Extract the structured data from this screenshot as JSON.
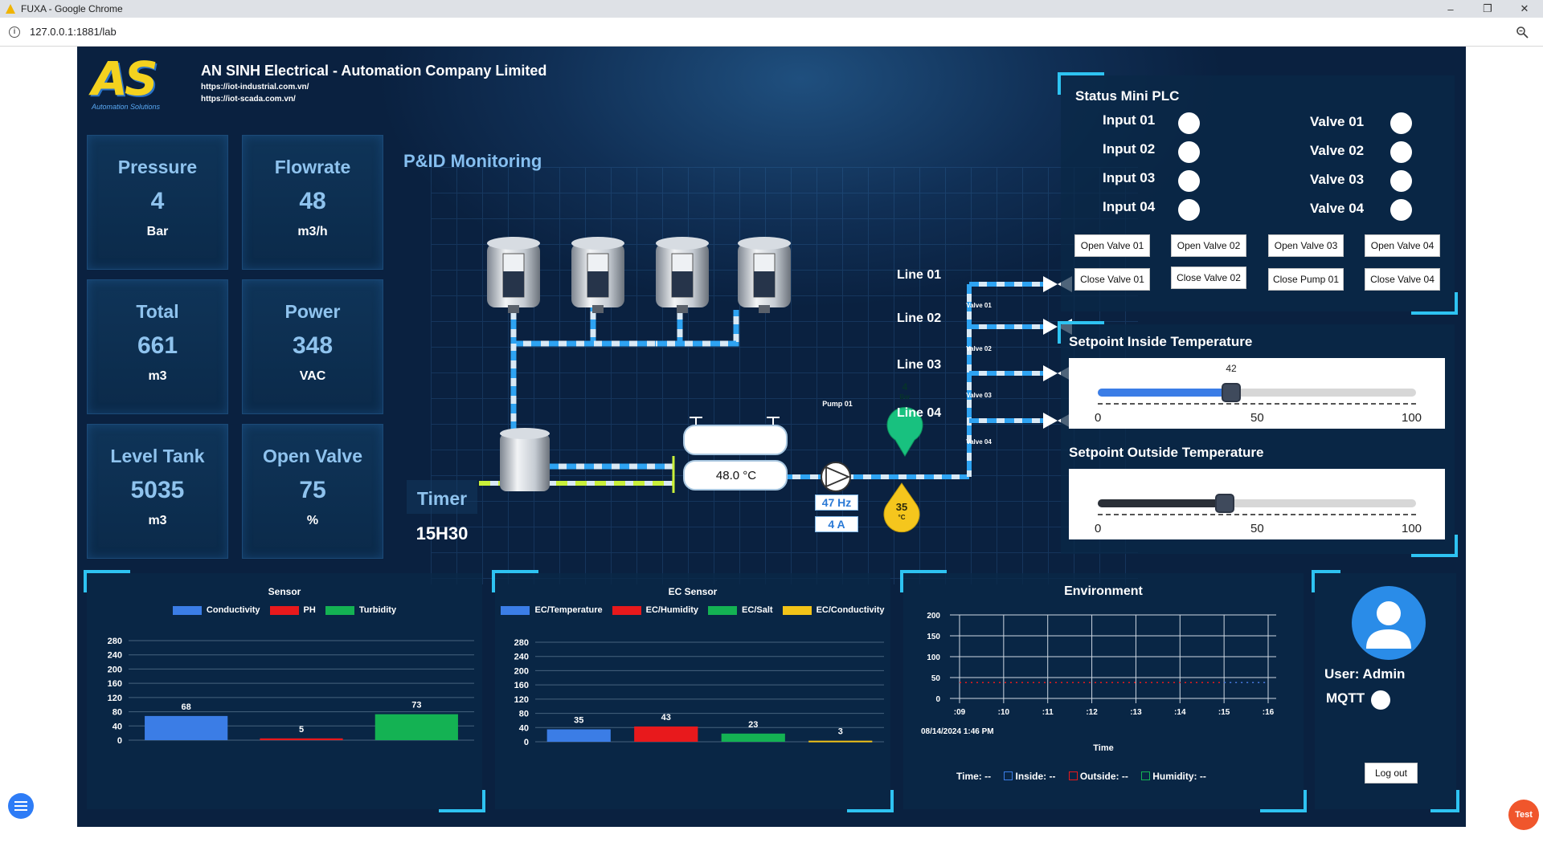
{
  "browser": {
    "window_title": "FUXA - Google Chrome",
    "url": "127.0.0.1:1881/lab"
  },
  "header": {
    "logo_text": "AS",
    "logo_sub": "Automation Solutions",
    "company_name": "AN SINH Electrical - Automation Company Limited",
    "link1": "https://iot-industrial.com.vn/",
    "link2": "https://iot-scada.com.vn/"
  },
  "cards": [
    {
      "title": "Pressure",
      "value": "4",
      "unit": "Bar"
    },
    {
      "title": "Flowrate",
      "value": "48",
      "unit": "m3/h"
    },
    {
      "title": "Total",
      "value": "661",
      "unit": "m3"
    },
    {
      "title": "Power",
      "value": "348",
      "unit": "VAC"
    },
    {
      "title": "Level Tank",
      "value": "5035",
      "unit": "m3"
    },
    {
      "title": "Open Valve",
      "value": "75",
      "unit": "%"
    }
  ],
  "pid": {
    "title": "P&ID Monitoring",
    "tank_temp": "48.0  °C",
    "pump_label": "Pump 01",
    "freq": "47 Hz",
    "current": "4 A",
    "pressure_value": "4",
    "pressure_unit": "Bar",
    "temp_value": "35",
    "temp_unit": "°C",
    "lines": [
      "Line 01",
      "Line 02",
      "Line 03",
      "Line 04"
    ],
    "valves": [
      "Valve 01",
      "Valve 02",
      "Valve 03",
      "Valve 04"
    ]
  },
  "timer": {
    "label": "Timer",
    "value": "15H30"
  },
  "plc": {
    "title": "Status Mini PLC",
    "inputs": [
      "Input 01",
      "Input 02",
      "Input 03",
      "Input 04"
    ],
    "valves": [
      "Valve 01",
      "Valve 02",
      "Valve 03",
      "Valve 04"
    ],
    "open_buttons": [
      "Open Valve 01",
      "Open Valve 02",
      "Open Valve 03",
      "Open Valve 04"
    ],
    "close_buttons": [
      "Close Valve 01",
      "Close Valve 02",
      "Close Pump 01",
      "Close Valve 04"
    ]
  },
  "setpoints": {
    "inside": {
      "title": "Setpoint Inside Temperature",
      "value": 42,
      "value_label": "42",
      "min": "0",
      "mid": "50",
      "max": "100"
    },
    "outside": {
      "title": "Setpoint Outside Temperature",
      "value": 40,
      "min": "0",
      "mid": "50",
      "max": "100"
    }
  },
  "colors": {
    "accent_cyan": "#2ec3f2",
    "blue": "#3b7de6",
    "red": "#e8191c",
    "green": "#14b253",
    "yellow": "#f2c318"
  },
  "chart_data": [
    {
      "type": "bar",
      "title": "Sensor",
      "categories": [
        "Conductivity",
        "PH",
        "Turbidity"
      ],
      "series": [
        {
          "name": "Conductivity",
          "values": [
            68
          ]
        },
        {
          "name": "PH",
          "values": [
            5
          ]
        },
        {
          "name": "Turbidity",
          "values": [
            73
          ]
        }
      ],
      "value_labels": [
        "68",
        "5",
        "73"
      ],
      "y_ticks": [
        "280",
        "240",
        "200",
        "160",
        "120",
        "80",
        "40",
        "0"
      ],
      "ylim": [
        0,
        280
      ],
      "legend": "top"
    },
    {
      "type": "bar",
      "title": "EC Sensor",
      "categories": [
        "EC/Temperature",
        "EC/Humidity",
        "EC/Salt",
        "EC/Conductivity"
      ],
      "series": [
        {
          "name": "EC/Temperature",
          "values": [
            35
          ]
        },
        {
          "name": "EC/Humidity",
          "values": [
            43
          ]
        },
        {
          "name": "EC/Salt",
          "values": [
            23
          ]
        },
        {
          "name": "EC/Conductivity",
          "values": [
            3
          ]
        }
      ],
      "value_labels": [
        "35",
        "43",
        "23",
        "3"
      ],
      "y_ticks": [
        "280",
        "240",
        "200",
        "160",
        "120",
        "80",
        "40",
        "0"
      ],
      "ylim": [
        0,
        280
      ],
      "legend": "top"
    },
    {
      "type": "line",
      "title": "Environment",
      "xlabel": "Time",
      "x_ticks": [
        ":09",
        ":10",
        ":11",
        ":12",
        ":13",
        ":14",
        ":15",
        ":16"
      ],
      "y_ticks": [
        "200",
        "150",
        "100",
        "50",
        "0"
      ],
      "ylim": [
        0,
        200
      ],
      "date_label": "08/14/2024 1:46 PM",
      "series": [
        {
          "name": "Outside",
          "values": [
            38,
            38,
            38,
            38,
            38,
            38,
            38,
            38
          ]
        },
        {
          "name": "Inside",
          "values": [
            null,
            null,
            null,
            null,
            null,
            null,
            38,
            38
          ]
        }
      ],
      "legend_items": [
        {
          "label": "Time:",
          "value": "--"
        },
        {
          "label": "Inside:",
          "value": "--"
        },
        {
          "label": "Outside:",
          "value": "--"
        },
        {
          "label": "Humidity:",
          "value": "--"
        }
      ]
    }
  ],
  "user": {
    "label": "User: Admin",
    "mqtt": "MQTT",
    "logout": "Log out"
  },
  "floating": {
    "test": "Test"
  }
}
